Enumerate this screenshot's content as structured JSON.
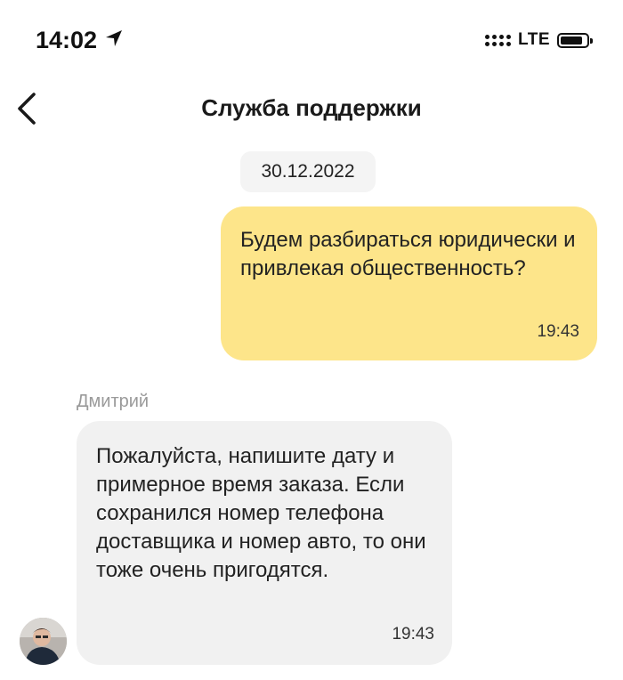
{
  "status_bar": {
    "time": "14:02",
    "location_icon": "location-arrow-icon",
    "signal_icon": "signal-dots-icon",
    "network": "LTE",
    "battery_icon": "battery-icon",
    "battery_level": 0.85
  },
  "nav": {
    "back_icon": "chevron-left-icon",
    "title": "Служба поддержки"
  },
  "chat": {
    "date": "30.12.2022",
    "messages": [
      {
        "direction": "outgoing",
        "text": "Будем разбираться юридически и привлекая общественность?",
        "time": "19:43",
        "bubble_color": "#fde58a"
      },
      {
        "direction": "incoming",
        "sender": "Дмитрий",
        "text": "Пожалуйста, напишите дату и примерное время заказа. Если сохранился номер телефона доставщика и номер авто, то они тоже очень пригодятся.",
        "time": "19:43",
        "bubble_color": "#f1f1f1"
      }
    ]
  }
}
